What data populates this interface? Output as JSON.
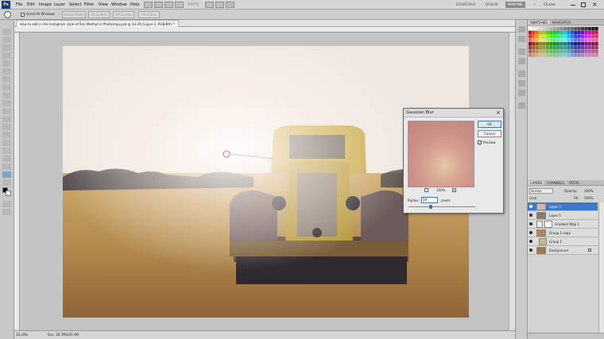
{
  "menubar": {
    "logo": "Ps",
    "menus": [
      "File",
      "Edit",
      "Image",
      "Layer",
      "Select",
      "Filter",
      "View",
      "Window",
      "Help"
    ],
    "zoom": "100%",
    "workspaces": [
      "ESSENTIALS",
      "DESIGN",
      "PAINTING"
    ],
    "active_workspace": "PAINTING",
    "cs_live": "CS Live",
    "more": "»"
  },
  "options": {
    "scroll_all_label": "Scroll All Windows",
    "buttons": [
      "Actual Pixels",
      "Fit Screen",
      "Fill Screen",
      "Print Size"
    ]
  },
  "document": {
    "tab_title": "How to edit in the Instagram style of Toni Mahfud in Photoshop.psd @ 33.3% (Layer 2, RGB/8#) *",
    "zoom": "33.33%",
    "doc_info": "Doc: 28.7M/141.9M"
  },
  "dialog": {
    "title": "Gaussian Blur",
    "ok": "OK",
    "cancel": "Cancel",
    "preview_label": "Preview",
    "preview_checked": true,
    "zoom": "100%",
    "radius_label": "Radius:",
    "radius_value": "58",
    "unit": "pixels",
    "slider_fraction": 0.33
  },
  "swatches": {
    "tabs": [
      "SWATCHES",
      "NAVIGATOR"
    ]
  },
  "layers": {
    "tabs": [
      "LAYERS",
      "CHANNELS",
      "PATHS"
    ],
    "blend_mode": "Screen",
    "opacity_label": "Opacity:",
    "opacity": "100%",
    "lock_label": "Lock:",
    "fill_label": "Fill:",
    "fill": "100%",
    "items": [
      {
        "name": "Layer 2",
        "selected": true
      },
      {
        "name": "Layer 1",
        "selected": false
      },
      {
        "name": "Gradient Map 1",
        "selected": false
      },
      {
        "name": "Group 1 copy",
        "selected": false
      },
      {
        "name": "Group 1",
        "selected": false
      },
      {
        "name": "Background",
        "selected": false
      }
    ]
  },
  "colors": {
    "accent": "#3e78c8",
    "dialog_preview": "#cf9389"
  }
}
